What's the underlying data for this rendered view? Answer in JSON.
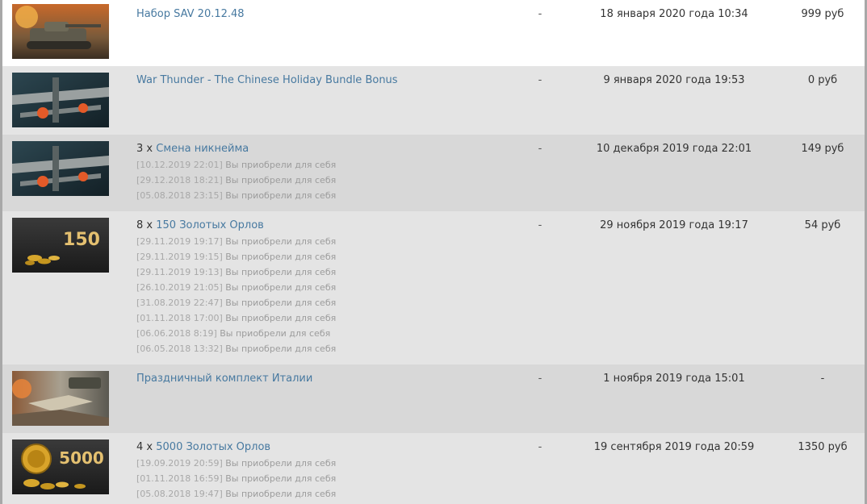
{
  "purchases": [
    {
      "quantity": "",
      "title": "Набор SAV 20.12.48",
      "status": "-",
      "date": "18 января 2020 года 10:34",
      "price": "999 руб",
      "history": []
    },
    {
      "quantity": "",
      "title": "War Thunder - The Chinese Holiday Bundle Bonus",
      "status": "-",
      "date": "9 января 2020 года 19:53",
      "price": "0 руб",
      "history": []
    },
    {
      "quantity": "3 x",
      "title": "Смена никнейма",
      "status": "-",
      "date": "10 декабря 2019 года 22:01",
      "price": "149 руб",
      "history": [
        {
          "ts": "[10.12.2019 22:01]",
          "text": "Вы приобрели для себя"
        },
        {
          "ts": "[29.12.2018 18:21]",
          "text": "Вы приобрели для себя"
        },
        {
          "ts": "[05.08.2018 23:15]",
          "text": "Вы приобрели для себя"
        }
      ]
    },
    {
      "quantity": "8 x",
      "title": "150 Золотых Орлов",
      "status": "-",
      "date": "29 ноября 2019 года 19:17",
      "price": "54 руб",
      "thumb_label": "150",
      "history": [
        {
          "ts": "[29.11.2019 19:17]",
          "text": "Вы приобрели для себя"
        },
        {
          "ts": "[29.11.2019 19:15]",
          "text": "Вы приобрели для себя"
        },
        {
          "ts": "[29.11.2019 19:13]",
          "text": "Вы приобрели для себя"
        },
        {
          "ts": "[26.10.2019 21:05]",
          "text": "Вы приобрели для себя"
        },
        {
          "ts": "[31.08.2019 22:47]",
          "text": "Вы приобрели для себя"
        },
        {
          "ts": "[01.11.2018 17:00]",
          "text": "Вы приобрели для себя"
        },
        {
          "ts": "[06.06.2018 8:19]",
          "text": "Вы приобрели для себя"
        },
        {
          "ts": "[06.05.2018 13:32]",
          "text": "Вы приобрели для себя"
        }
      ]
    },
    {
      "quantity": "",
      "title": "Праздничный комплект Италии",
      "status": "-",
      "date": "1 ноября 2019 года 15:01",
      "price": "-",
      "history": []
    },
    {
      "quantity": "4 x",
      "title": "5000 Золотых Орлов",
      "status": "-",
      "date": "19 сентября 2019 года 20:59",
      "price": "1350 руб",
      "thumb_label": "5000",
      "history": [
        {
          "ts": "[19.09.2019 20:59]",
          "text": "Вы приобрели для себя"
        },
        {
          "ts": "[01.11.2018 16:59]",
          "text": "Вы приобрели для себя"
        },
        {
          "ts": "[05.08.2018 19:47]",
          "text": "Вы приобрели для себя"
        }
      ]
    }
  ],
  "colors": {
    "link": "#4779a0",
    "history_text": "#9c9c9c",
    "row_white": "#ffffff",
    "row_light": "#e4e4e4",
    "row_dark": "#d8d8d8"
  }
}
